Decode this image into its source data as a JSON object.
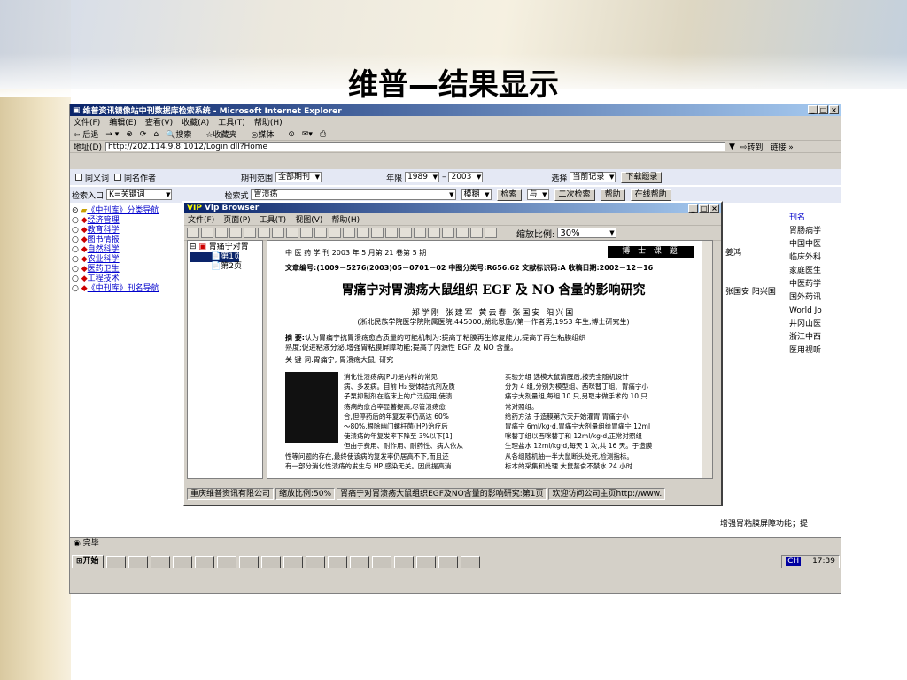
{
  "slide": {
    "title": "维普—结果显示"
  },
  "ie": {
    "title": "维普资讯镜像站中刊数据库检索系统 - Microsoft Internet Explorer",
    "menu": [
      "文件(F)",
      "编辑(E)",
      "查看(V)",
      "收藏(A)",
      "工具(T)",
      "帮助(H)"
    ],
    "toolbar": {
      "back": "⇦ 后退",
      "search": "搜索",
      "favorites": "收藏夹",
      "media": "媒体"
    },
    "address_label": "地址(D)",
    "address_value": "http://202.114.9.8:1012/Login.dll?Home",
    "go_label": "转到",
    "links_label": "链接 »",
    "status": "完毕"
  },
  "search": {
    "synonym": "同义词",
    "same_author": "同名作者",
    "range_label": "期刊范围",
    "range_value": "全部期刊",
    "year_label": "年限",
    "year_from": "1989",
    "year_dash": "–",
    "year_to": "2003",
    "select_label": "选择",
    "select_value": "当前记录",
    "download_btn": "下载题录",
    "entry_label": "检索入口",
    "entry_value": "K=关键词",
    "expr_label": "检索式",
    "expr_value": "胃溃疡",
    "mode_value": "模糊",
    "search_btn": "检索",
    "logic_value": "与",
    "second_search_btn": "二次检索",
    "help_btn": "帮助",
    "online_help_btn": "在线帮助"
  },
  "nav": {
    "root": "《中刊库》分类导航",
    "items": [
      "经济管理",
      "教育科学",
      "图书情报",
      "自然科学",
      "农业科学",
      "医药卫生",
      "工程技术"
    ],
    "journal_nav": "《中刊库》刊名导航"
  },
  "results": {
    "col_header": "刊名",
    "journals": [
      "胃肠病学",
      "中国中医",
      "临床外科",
      "家庭医生",
      "中医药学",
      "国外药讯",
      "World Jo",
      "井冈山医",
      "浙江中西",
      "医用视听"
    ],
    "author_1": "姜鸿",
    "author_2": "张国安 阳兴国",
    "snippet": "增强胃粘膜屏障功能；提"
  },
  "vip": {
    "title": "Vip Browser",
    "menu": [
      "文件(F)",
      "页面(P)",
      "工具(T)",
      "视图(V)",
      "帮助(H)"
    ],
    "zoom_label": "缩放比例:",
    "zoom_value": "30%",
    "tree_root": "胃痛宁对胃",
    "tree_pages": [
      "第1页",
      "第2页"
    ],
    "status": [
      "重庆维普资讯有限公司",
      "缩放比例:50%",
      "胃痛宁对胃溃疡大鼠组织EGF及NO含量的影响研究:第1页",
      "欢迎访问公司主页http://www."
    ]
  },
  "article": {
    "journal": "中 医 药 学 刊   2003 年 5 月第 21 卷第 5 期",
    "boshi": "博 士 课 题",
    "codes": "文章编号:(1009－5276(2003)05－0701－02   中图分类号:R656.62   文献标识码:A   收稿日期:2002－12－16",
    "title": "胃痛宁对胃溃疡大鼠组织 EGF 及 NO 含量的影响研究",
    "authors": "郑学刚    张建军    黄云春    张国安    阳兴国",
    "affiliation": "(浙北民族学院医学院附属医院,445000,湖北恩施//第一作者男,1953 年生,博士研究生)",
    "abstract_label": "摘  要:",
    "abstract_1": "认为胃痛宁抗胃溃疡愈合质量的可能机制为:提高了粘膜再生修复能力,提高了再生粘膜组织",
    "abstract_2": "熟度;促进粘液分泌,增强胃粘膜屏障功能;提高了内源性 EGF 及 NO 含量。",
    "keywords": "关  键  词:胃痛宁;    胃溃疡大鼠;    研究",
    "col1": [
      "消化性溃疡病(PU)是内科的常见",
      "病、多发病。目前 H₂ 受体拮抗剂及质",
      "子泵抑制剂在临床上的广泛应用,使溃",
      "疡病的愈合率显著提高,尽管溃疡愈",
      "合,但停药后的年复发率仍高达 60%",
      "～80%,根除幽门螺杆菌(HP)治疗后",
      "使溃疡的年复发率下降至 3%以下[1],",
      "但由于费用、耐作用、耐药性、病人依从",
      "性等问题的存在,最终使该病的复发率仍居高不下,而且还",
      "有一部分消化性溃疡的发生与 HP 感染无关。因此提高消"
    ],
    "col2": [
      "实验分组   选模大鼠清醒后,按完全随机设计",
      "分为 4 组,分别为模型组、西咪替丁组、胃痛宁小",
      "痛宁大剂量组,每组 10 只,另取未做手术的 10 只",
      "常对照组。",
      "给药方法   于造膜第六天开始灌胃,胃痛宁小",
      "胃痛宁 6ml/kg·d,胃痛宁大剂量组给胃痛宁 12ml",
      "咪替丁组以西咪替丁和 12ml/kg·d,正常对照组",
      "生理盐水 12ml/kg·d,每天 1 次,共 16 天。于造膜",
      "从各组随机抽一半大鼠断头处死,检测指标。",
      "标本的采集和处理   大鼠禁食不禁水 24 小时"
    ]
  },
  "taskbar": {
    "start": "开始",
    "clock": "17:39",
    "ime": "CH"
  }
}
